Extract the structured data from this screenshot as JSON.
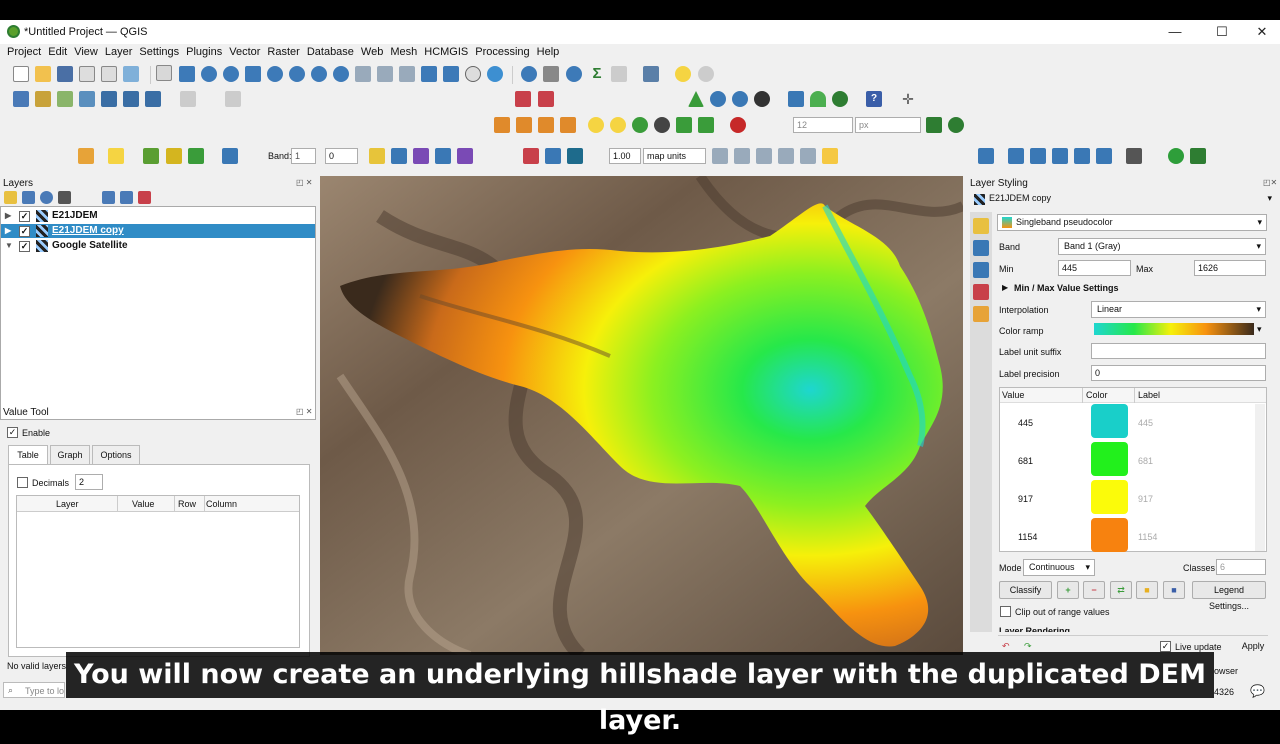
{
  "window": {
    "title": "*Untitled Project — QGIS",
    "min": "—",
    "max": "☐",
    "close": "✕"
  },
  "menu": [
    "Project",
    "Edit",
    "View",
    "Layer",
    "Settings",
    "Plugins",
    "Vector",
    "Raster",
    "Database",
    "Web",
    "Mesh",
    "HCMGIS",
    "Processing",
    "Help"
  ],
  "toolbar": {
    "band_label": "Band:",
    "band_value": "1",
    "band_opacity": "0",
    "line_width": "1.00",
    "units": "map units",
    "font_size": "12",
    "font_unit": "px"
  },
  "layers_panel": {
    "title": "Layers",
    "items": [
      {
        "name": "E21JDEM",
        "checked": "✓"
      },
      {
        "name": "E21JDEM copy",
        "checked": "✓"
      },
      {
        "name": "Google Satellite",
        "checked": "✓"
      }
    ]
  },
  "value_tool": {
    "title": "Value Tool",
    "enable_label": "Enable",
    "enable_checked": "✓",
    "tabs": [
      "Table",
      "Graph",
      "Options"
    ],
    "decimals_label": "Decimals",
    "decimals_value": "2",
    "columns": [
      "Layer",
      "Value",
      "Row",
      "Column"
    ]
  },
  "layer_styling": {
    "title": "Layer Styling",
    "layer": "E21JDEM copy",
    "renderer": "Singleband pseudocolor",
    "band_label": "Band",
    "band_value": "Band 1 (Gray)",
    "min_label": "Min",
    "min_value": "445",
    "max_label": "Max",
    "max_value": "1626",
    "minmax_section": "Min / Max Value Settings",
    "interpolation_label": "Interpolation",
    "interpolation_value": "Linear",
    "ramp_label": "Color ramp",
    "suffix_label": "Label unit suffix",
    "precision_label": "Label precision",
    "precision_value": "0",
    "table_headers": [
      "Value",
      "Color",
      "Label"
    ],
    "classes": [
      {
        "value": "445",
        "color": "#19cfc9",
        "label": "445"
      },
      {
        "value": "681",
        "color": "#22f01c",
        "label": "681"
      },
      {
        "value": "917",
        "color": "#fbfb0a",
        "label": "917"
      },
      {
        "value": "1154",
        "color": "#f7820f",
        "label": "1154"
      }
    ],
    "mode_label": "Mode",
    "mode_value": "Continuous",
    "classes_label": "Classes",
    "classes_value": "6",
    "classify_btn": "Classify",
    "legend_btn": "Legend Settings...",
    "clip_label": "Clip out of range values",
    "rendering_section": "Layer Rendering",
    "live_update_label": "Live update",
    "live_update_checked": "✓",
    "apply_btn": "Apply"
  },
  "statusbar": {
    "message": "No valid layers",
    "locator": "Type to lo",
    "crs_fragment": "4326",
    "browser_fragment": "owser"
  },
  "caption": "You will now create an underlying hillshade layer with the duplicated DEM layer."
}
